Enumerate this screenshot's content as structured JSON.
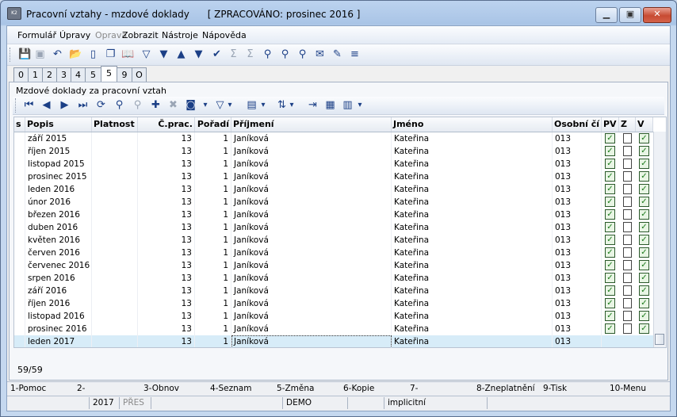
{
  "window": {
    "title": "Pracovní vztahy - mzdové doklady",
    "status_label": "[ ZPRACOVÁNO: prosinec 2016 ]",
    "minimize_icon": "minimize-icon",
    "maximize_icon": "maximize-icon",
    "close_icon": "close-icon",
    "app_icon": "app-icon"
  },
  "menu": [
    {
      "label": "Formulář",
      "enabled": true
    },
    {
      "label": "Úpravy",
      "enabled": true
    },
    {
      "label": "Oprava",
      "enabled": false
    },
    {
      "label": "Zobrazit",
      "enabled": true
    },
    {
      "label": "Nástroje",
      "enabled": true
    },
    {
      "label": "Nápověda",
      "enabled": true
    }
  ],
  "toolbar_icons": [
    "save-icon",
    "save-all-icon",
    "undo-icon",
    "open-folder-icon",
    "new-document-icon",
    "copy-icon",
    "book-icon",
    "filter-icon",
    "filter-settings-icon",
    "arrow-up-icon",
    "arrow-down-icon",
    "check-filter-icon",
    "sum-icon",
    "subtotal-icon",
    "binoculars-icon",
    "find-next-icon",
    "find-replace-icon",
    "mail-icon",
    "edit-icon",
    "list-icon"
  ],
  "tabs": [
    "0",
    "1",
    "2",
    "3",
    "4",
    "5",
    "5",
    "9",
    "O"
  ],
  "active_tab_index": 6,
  "panel": {
    "title": "Mzdové doklady za pracovní vztah",
    "nav_icons": [
      "first-icon",
      "prev-icon",
      "next-icon",
      "last-icon",
      "refresh-doc-icon",
      "binoculars-icon",
      "find-dim-icon",
      "add-icon",
      "remove-icon",
      "camera-icon",
      "dropdown-icon",
      "filter-icon",
      "dropdown-icon",
      "columns-icon",
      "dropdown-icon",
      "sort-icon",
      "dropdown-icon",
      "indent-icon",
      "export-icon",
      "report-icon",
      "dropdown-icon"
    ]
  },
  "grid": {
    "columns": [
      "s",
      "Popis",
      "Platnost",
      "Č.prac.",
      "Pořadí",
      "Příjmení",
      "Jméno",
      "Osobní čí",
      "PV",
      "Z",
      "V"
    ],
    "rows": [
      {
        "popis": "září 2015",
        "cprac": "13",
        "poradi": "1",
        "prijmeni": "Janíková",
        "jmeno": "Kateřina",
        "osobni": "013",
        "pv": true,
        "z": true,
        "v": true
      },
      {
        "popis": "říjen 2015",
        "cprac": "13",
        "poradi": "1",
        "prijmeni": "Janíková",
        "jmeno": "Kateřina",
        "osobni": "013",
        "pv": true,
        "z": true,
        "v": true
      },
      {
        "popis": "listopad 2015",
        "cprac": "13",
        "poradi": "1",
        "prijmeni": "Janíková",
        "jmeno": "Kateřina",
        "osobni": "013",
        "pv": true,
        "z": true,
        "v": true
      },
      {
        "popis": "prosinec 2015",
        "cprac": "13",
        "poradi": "1",
        "prijmeni": "Janíková",
        "jmeno": "Kateřina",
        "osobni": "013",
        "pv": true,
        "z": true,
        "v": true
      },
      {
        "popis": "leden 2016",
        "cprac": "13",
        "poradi": "1",
        "prijmeni": "Janíková",
        "jmeno": "Kateřina",
        "osobni": "013",
        "pv": true,
        "z": true,
        "v": true
      },
      {
        "popis": "únor 2016",
        "cprac": "13",
        "poradi": "1",
        "prijmeni": "Janíková",
        "jmeno": "Kateřina",
        "osobni": "013",
        "pv": true,
        "z": true,
        "v": true
      },
      {
        "popis": "březen 2016",
        "cprac": "13",
        "poradi": "1",
        "prijmeni": "Janíková",
        "jmeno": "Kateřina",
        "osobni": "013",
        "pv": true,
        "z": true,
        "v": true
      },
      {
        "popis": "duben 2016",
        "cprac": "13",
        "poradi": "1",
        "prijmeni": "Janíková",
        "jmeno": "Kateřina",
        "osobni": "013",
        "pv": true,
        "z": true,
        "v": true
      },
      {
        "popis": "květen 2016",
        "cprac": "13",
        "poradi": "1",
        "prijmeni": "Janíková",
        "jmeno": "Kateřina",
        "osobni": "013",
        "pv": true,
        "z": true,
        "v": true
      },
      {
        "popis": "červen 2016",
        "cprac": "13",
        "poradi": "1",
        "prijmeni": "Janíková",
        "jmeno": "Kateřina",
        "osobni": "013",
        "pv": true,
        "z": true,
        "v": true
      },
      {
        "popis": "červenec 2016",
        "cprac": "13",
        "poradi": "1",
        "prijmeni": "Janíková",
        "jmeno": "Kateřina",
        "osobni": "013",
        "pv": true,
        "z": true,
        "v": true
      },
      {
        "popis": "srpen 2016",
        "cprac": "13",
        "poradi": "1",
        "prijmeni": "Janíková",
        "jmeno": "Kateřina",
        "osobni": "013",
        "pv": true,
        "z": true,
        "v": true
      },
      {
        "popis": "září 2016",
        "cprac": "13",
        "poradi": "1",
        "prijmeni": "Janíková",
        "jmeno": "Kateřina",
        "osobni": "013",
        "pv": true,
        "z": true,
        "v": true
      },
      {
        "popis": "říjen 2016",
        "cprac": "13",
        "poradi": "1",
        "prijmeni": "Janíková",
        "jmeno": "Kateřina",
        "osobni": "013",
        "pv": true,
        "z": true,
        "v": true
      },
      {
        "popis": "listopad 2016",
        "cprac": "13",
        "poradi": "1",
        "prijmeni": "Janíková",
        "jmeno": "Kateřina",
        "osobni": "013",
        "pv": true,
        "z": true,
        "v": true
      },
      {
        "popis": "prosinec 2016",
        "cprac": "13",
        "poradi": "1",
        "prijmeni": "Janíková",
        "jmeno": "Kateřina",
        "osobni": "013",
        "pv": true,
        "z": true,
        "v": true
      },
      {
        "popis": "leden 2017",
        "cprac": "13",
        "poradi": "1",
        "prijmeni": "Janíková",
        "jmeno": "Kateřina",
        "osobni": "013",
        "pv": false,
        "z": false,
        "v": false
      }
    ],
    "selected_row_index": 16,
    "record_counter": "59/59"
  },
  "function_keys": [
    "1-Pomoc",
    "2-",
    "3-Obnov",
    "4-Seznam",
    "5-Změna",
    "6-Kopie",
    "7-",
    "8-Zneplatnění",
    "9-Tisk",
    "10-Menu"
  ],
  "status_bar": {
    "year": "2017",
    "mode": "PŘES",
    "database": "DEMO",
    "option": "implicitní"
  },
  "colors": {
    "selected_row": "#d7ecf8",
    "title_bar": "#bcd3ef",
    "close_button": "#c74b32"
  }
}
